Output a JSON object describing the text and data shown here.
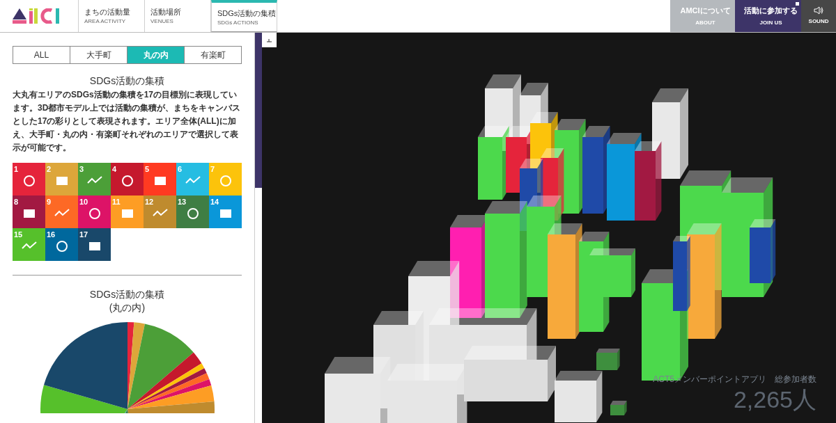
{
  "header": {
    "nav_tabs": [
      {
        "label": "まちの活動量",
        "sublabel": "AREA ACTIVITY",
        "selected": false
      },
      {
        "label": "活動場所",
        "sublabel": "VENUES",
        "selected": false
      },
      {
        "label": "SDGs活動の集積",
        "sublabel": "SDGs ACTIONS",
        "selected": true
      }
    ],
    "right_buttons": [
      {
        "kind": "about",
        "label": "AMCIについて",
        "sublabel": "ABOUT"
      },
      {
        "kind": "join",
        "label": "活動に参加する",
        "sublabel": "JOIN US"
      },
      {
        "kind": "sound",
        "sublabel": "SOUND"
      }
    ]
  },
  "sidebar": {
    "area_tabs": [
      {
        "label": "ALL",
        "selected": false
      },
      {
        "label": "大手町",
        "selected": false
      },
      {
        "label": "丸の内",
        "selected": true
      },
      {
        "label": "有楽町",
        "selected": false
      }
    ],
    "title": "SDGs活動の集積",
    "description": "大丸有エリアのSDGs活動の集積を17の目標別に表現しています。3D都市モデル上では活動の集積が、まちをキャンバスとした17の彩りとして表現されます。エリア全体(ALL)に加え、大手町・丸の内・有楽町それぞれのエリアで選択して表示が可能です。",
    "sdg_tiles": [
      {
        "number": "1",
        "color": "#e5243b"
      },
      {
        "number": "2",
        "color": "#dda63a"
      },
      {
        "number": "3",
        "color": "#4c9f38"
      },
      {
        "number": "4",
        "color": "#c5192d"
      },
      {
        "number": "5",
        "color": "#ff3a21"
      },
      {
        "number": "6",
        "color": "#26bde2"
      },
      {
        "number": "7",
        "color": "#fcc30b"
      },
      {
        "number": "8",
        "color": "#a21942"
      },
      {
        "number": "9",
        "color": "#fd6925"
      },
      {
        "number": "10",
        "color": "#dd1367"
      },
      {
        "number": "11",
        "color": "#fd9d24"
      },
      {
        "number": "12",
        "color": "#bf8b2e"
      },
      {
        "number": "13",
        "color": "#3f7e44"
      },
      {
        "number": "14",
        "color": "#0a97d9"
      },
      {
        "number": "15",
        "color": "#56c02b"
      },
      {
        "number": "16",
        "color": "#00689d"
      },
      {
        "number": "17",
        "color": "#19486a"
      }
    ],
    "chart_title": [
      "SDGs活動の集積",
      "(丸の内)"
    ]
  },
  "map": {
    "caption": "ACT5メンバーポイントアプリ　総参加者数",
    "count": "2,265人"
  }
}
